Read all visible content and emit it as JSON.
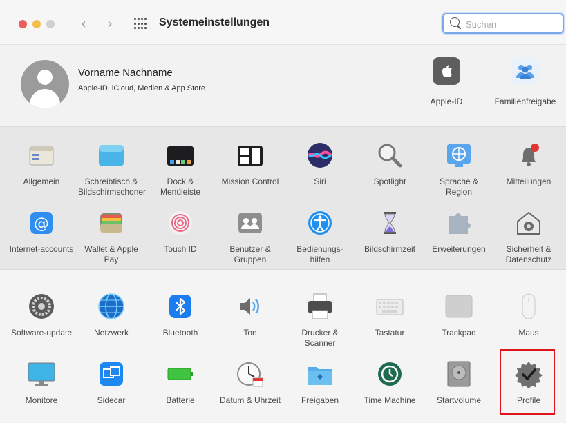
{
  "window": {
    "title": "Systemeinstellungen"
  },
  "toolbar": {
    "back_glyph": "‹",
    "forward_glyph": "›",
    "search_placeholder": "Suchen"
  },
  "account": {
    "name": "Vorname Nachname",
    "subtitle": "Apple-ID, iCloud, Medien & App Store",
    "items": [
      {
        "label": "Apple-ID",
        "icon": "apple-logo-icon"
      },
      {
        "label": "Familienfreigabe",
        "icon": "family-sharing-icon"
      }
    ]
  },
  "panes_row1": [
    {
      "label": "Allgemein",
      "icon": "general-icon"
    },
    {
      "label": "Schreibtisch & Bildschirmschoner",
      "icon": "desktop-screensaver-icon"
    },
    {
      "label": "Dock & Menüleiste",
      "icon": "dock-menubar-icon"
    },
    {
      "label": "Mission Control",
      "icon": "mission-control-icon"
    },
    {
      "label": "Siri",
      "icon": "siri-icon"
    },
    {
      "label": "Spotlight",
      "icon": "spotlight-icon"
    },
    {
      "label": "Sprache & Region",
      "icon": "language-region-icon"
    },
    {
      "label": "Mitteilungen",
      "icon": "notifications-icon"
    }
  ],
  "panes_row2": [
    {
      "label": "Internet-accounts",
      "icon": "internet-accounts-icon"
    },
    {
      "label": "Wallet & Apple Pay",
      "icon": "wallet-icon"
    },
    {
      "label": "Touch ID",
      "icon": "touch-id-icon"
    },
    {
      "label": "Benutzer & Gruppen",
      "icon": "users-groups-icon"
    },
    {
      "label": "Bedienungs-hilfen",
      "icon": "accessibility-icon"
    },
    {
      "label": "Bildschirmzeit",
      "icon": "screen-time-icon"
    },
    {
      "label": "Erweiterungen",
      "icon": "extensions-icon"
    },
    {
      "label": "Sicherheit & Datenschutz",
      "icon": "security-privacy-icon"
    }
  ],
  "panes_row3": [
    {
      "label": "Software-update",
      "icon": "software-update-icon"
    },
    {
      "label": "Netzwerk",
      "icon": "network-icon"
    },
    {
      "label": "Bluetooth",
      "icon": "bluetooth-icon"
    },
    {
      "label": "Ton",
      "icon": "sound-icon"
    },
    {
      "label": "Drucker & Scanner",
      "icon": "printer-scanner-icon"
    },
    {
      "label": "Tastatur",
      "icon": "keyboard-icon"
    },
    {
      "label": "Trackpad",
      "icon": "trackpad-icon"
    },
    {
      "label": "Maus",
      "icon": "mouse-icon"
    }
  ],
  "panes_row4": [
    {
      "label": "Monitore",
      "icon": "displays-icon"
    },
    {
      "label": "Sidecar",
      "icon": "sidecar-icon"
    },
    {
      "label": "Batterie",
      "icon": "battery-icon"
    },
    {
      "label": "Datum & Uhrzeit",
      "icon": "date-time-icon"
    },
    {
      "label": "Freigaben",
      "icon": "sharing-icon"
    },
    {
      "label": "Time Machine",
      "icon": "time-machine-icon"
    },
    {
      "label": "Startvolume",
      "icon": "startup-disk-icon"
    },
    {
      "label": "Profile",
      "icon": "profiles-icon",
      "highlighted": true
    }
  ],
  "colors": {
    "highlight_border": "#e1141c",
    "search_focus": "#7aa7e6"
  }
}
